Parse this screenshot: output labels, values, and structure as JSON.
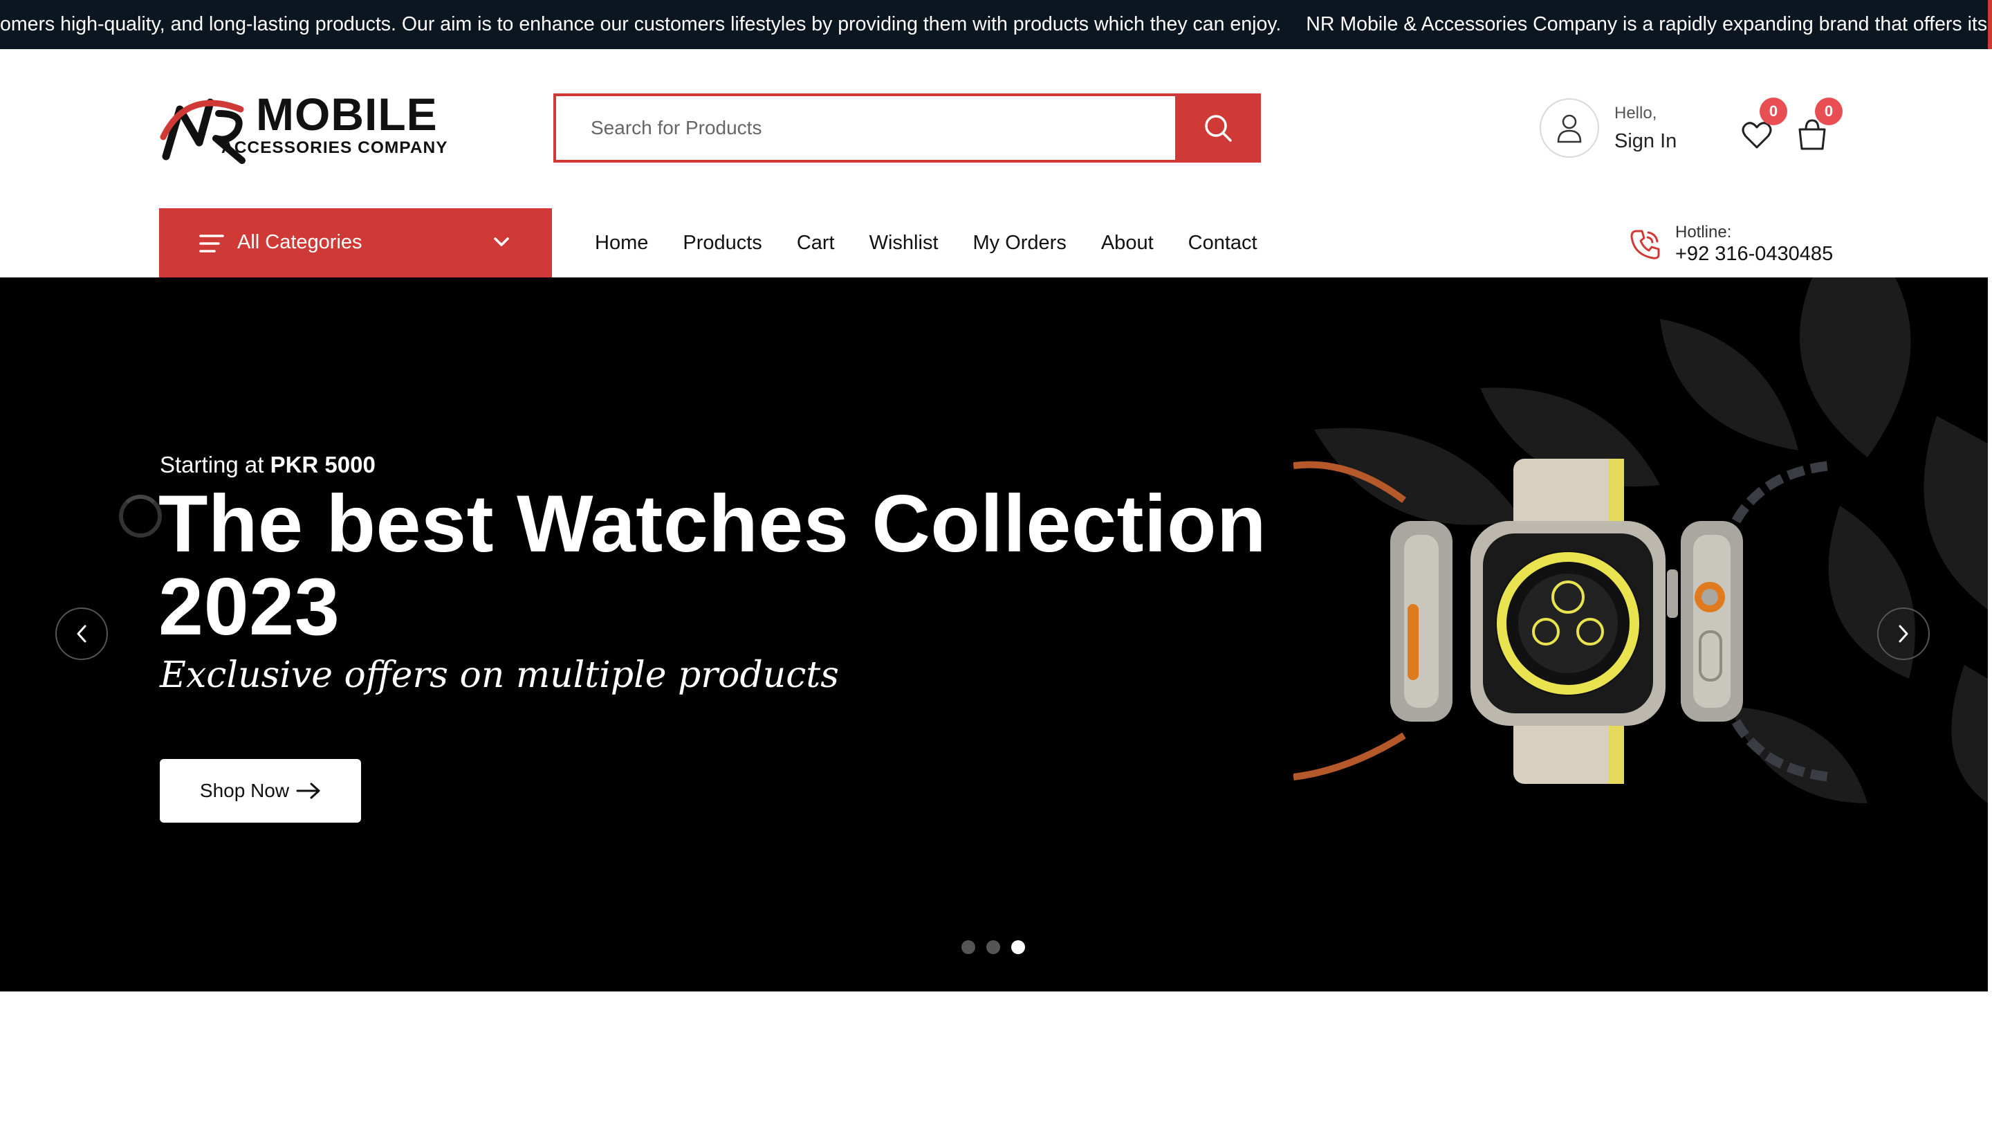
{
  "topbar": {
    "marquee": [
      "omers high-quality, and long-lasting products. Our aim is to enhance our customers lifestyles by providing them with products which they can enjoy.",
      "NR Mobile & Accessories Company is a rapidly expanding brand that offers its custo"
    ]
  },
  "header": {
    "logo": {
      "word1": "MOBILE",
      "word2": "ACCESSORIES COMPANY"
    },
    "search": {
      "placeholder": "Search for Products"
    },
    "account": {
      "greeting": "Hello,",
      "action": "Sign In"
    },
    "wishlist_count": "0",
    "cart_count": "0"
  },
  "nav": {
    "categories_label": "All Categories",
    "links": [
      "Home",
      "Products",
      "Cart",
      "Wishlist",
      "My Orders",
      "About",
      "Contact"
    ],
    "hotline": {
      "label": "Hotline:",
      "number": "+92 316-0430485"
    }
  },
  "hero": {
    "kicker_prefix": "Starting at ",
    "kicker_price": "PKR 5000",
    "title": "The best Watches Collection 2023",
    "subtitle": "Exclusive offers on multiple products",
    "cta": "Shop Now",
    "slides": {
      "total": 3,
      "active": 3
    }
  },
  "colors": {
    "accent": "#d03a36",
    "topbar_bg": "#0b1620",
    "hero_bg": "#000000",
    "badge": "#e94e52"
  },
  "icons": {
    "search": "search-icon",
    "user": "user-icon",
    "wishlist": "heart-icon",
    "cart": "shopping-bag-icon",
    "menu": "menu-icon",
    "chevron": "chevron-down-icon",
    "phone": "phone-icon",
    "prev": "chevron-left-icon",
    "next": "chevron-right-icon",
    "arrow": "arrow-right-icon"
  }
}
